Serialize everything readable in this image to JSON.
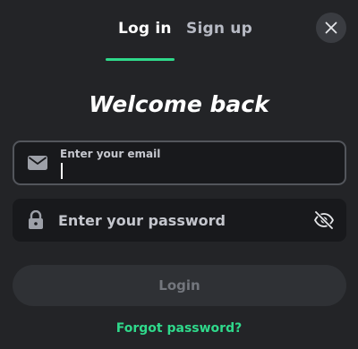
{
  "tabs": {
    "login_label": "Log in",
    "signup_label": "Sign up",
    "active": "login"
  },
  "close_icon": "close-icon",
  "title": "Welcome back",
  "email": {
    "label": "Enter your email",
    "value": "",
    "icon": "envelope-icon"
  },
  "password": {
    "placeholder": "Enter your password",
    "value": "",
    "lock_icon": "lock-icon",
    "toggle_icon": "eye-off-icon"
  },
  "login_button": "Login",
  "forgot_link": "Forgot password?",
  "colors": {
    "background": "#232427",
    "accent": "#2fd98b",
    "field_bg": "#18191c",
    "button_disabled": "#2f3135"
  }
}
